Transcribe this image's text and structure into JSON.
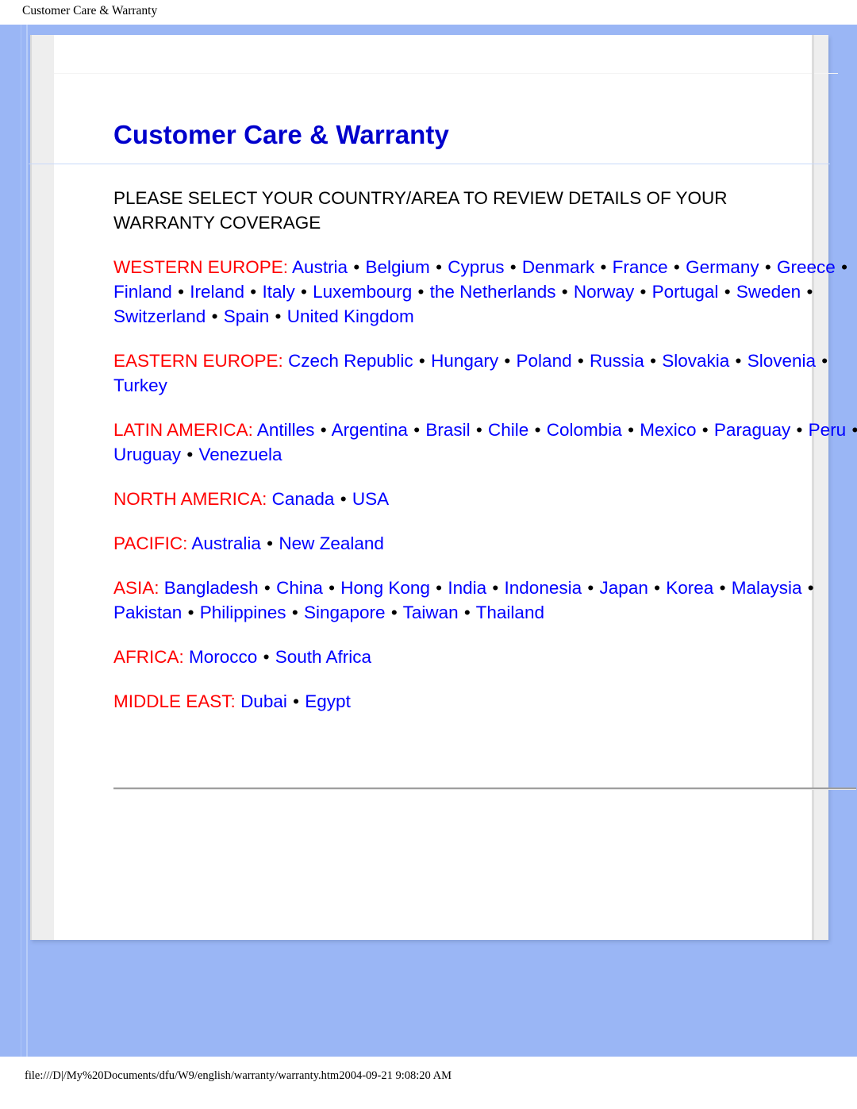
{
  "print_header": {
    "title": "Customer Care & Warranty"
  },
  "document": {
    "title": "Customer Care & Warranty",
    "subtitle": "PLEASE SELECT YOUR COUNTRY/AREA TO REVIEW DETAILS OF YOUR WARRANTY COVERAGE",
    "bullet": "•",
    "regions": [
      {
        "label": "WESTERN EUROPE:",
        "countries": [
          "Austria",
          "Belgium",
          "Cyprus",
          "Denmark",
          "France",
          "Germany",
          "Greece",
          "Finland",
          "Ireland",
          "Italy",
          "Luxembourg",
          "the Netherlands",
          "Norway",
          "Portugal",
          "Sweden",
          "Switzerland",
          "Spain",
          "United Kingdom"
        ]
      },
      {
        "label": "EASTERN EUROPE:",
        "countries": [
          "Czech Republic",
          "Hungary",
          "Poland",
          "Russia",
          "Slovakia",
          "Slovenia",
          "Turkey"
        ]
      },
      {
        "label": "LATIN AMERICA:",
        "countries": [
          "Antilles",
          "Argentina",
          "Brasil",
          "Chile",
          "Colombia",
          "Mexico",
          "Paraguay",
          "Peru",
          "Uruguay",
          "Venezuela"
        ]
      },
      {
        "label": "NORTH AMERICA:",
        "countries": [
          "Canada",
          "USA"
        ]
      },
      {
        "label": "PACIFIC:",
        "countries": [
          "Australia",
          "New Zealand"
        ]
      },
      {
        "label": "ASIA:",
        "countries": [
          "Bangladesh",
          "China",
          "Hong Kong",
          "India",
          "Indonesia",
          "Japan",
          "Korea",
          "Malaysia",
          "Pakistan",
          "Philippines",
          "Singapore",
          "Taiwan",
          "Thailand"
        ]
      },
      {
        "label": "AFRICA:",
        "countries": [
          "Morocco",
          "South Africa"
        ]
      },
      {
        "label": "MIDDLE EAST:",
        "countries": [
          "Dubai",
          "Egypt"
        ]
      }
    ]
  },
  "print_footer": {
    "text": "file:///D|/My%20Documents/dfu/W9/english/warranty/warranty.htm2004-09-21 9:08:20 AM"
  },
  "colors": {
    "page_background": "#9ab6f5",
    "panel_background": "#ffffff",
    "panel_bevel": "#eeeeee",
    "title_blue": "#0000cc",
    "region_label_red": "#ff0000",
    "link_blue": "#0000ff",
    "body_text": "#000000",
    "divider_gray": "#9e9e9e"
  }
}
